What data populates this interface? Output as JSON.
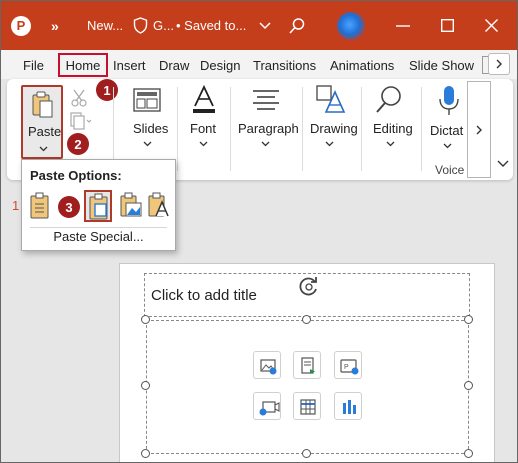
{
  "titlebar": {
    "app_logo_letter": "P",
    "more_glyph": "»",
    "doc_name": "New...",
    "sensitivity_label": "G...",
    "saved_status": "• Saved to...",
    "colors": {
      "background": "#c43e1c"
    }
  },
  "tabs": [
    "File",
    "Home",
    "Insert",
    "Draw",
    "Design",
    "Transitions",
    "Animations",
    "Slide Show"
  ],
  "ribbon": {
    "paste_label": "Paste",
    "slides_label": "Slides",
    "font_label": "Font",
    "paragraph_label": "Paragraph",
    "drawing_label": "Drawing",
    "editing_label": "Editing",
    "dictate_label": "Dictat",
    "voice_group_label": "Voice"
  },
  "badges": {
    "one": "1",
    "two": "2",
    "three": "3"
  },
  "paste_menu": {
    "title": "Paste Options:",
    "options": [
      "use-destination-theme",
      "keep-source-formatting",
      "picture",
      "keep-text-only"
    ],
    "paste_special": "Paste Special..."
  },
  "left_mark": "1",
  "slide": {
    "title_placeholder": "Click to add title",
    "content_icons": [
      "insert-picture-icon",
      "insert-icon-icon",
      "insert-cameo-icon",
      "insert-video-icon",
      "insert-table-icon",
      "insert-chart-icon"
    ]
  },
  "accent_colors": {
    "highlight_border": "#c8102e",
    "badge": "#a01e1e"
  }
}
